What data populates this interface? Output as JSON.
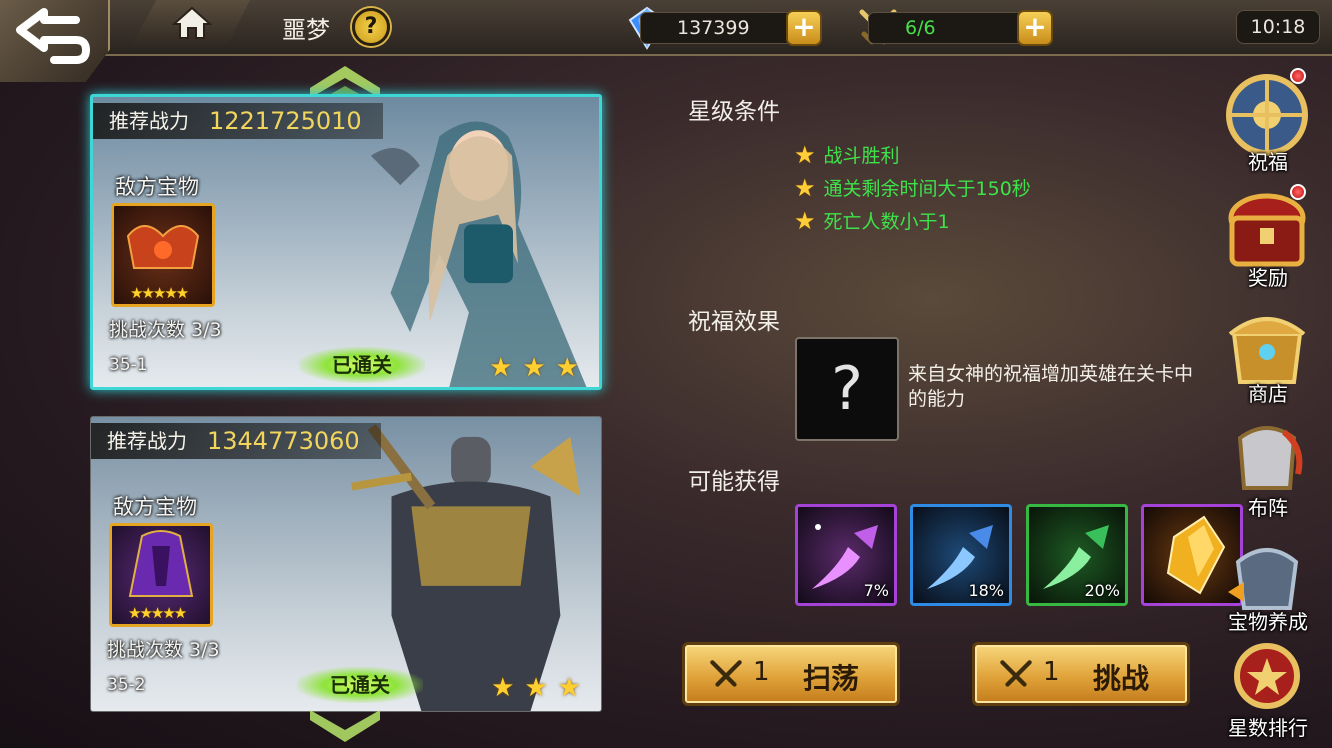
{
  "header": {
    "title": "噩梦",
    "gems": "137399",
    "stamina": "6/6",
    "time": "10:18",
    "plus_label": "+"
  },
  "stages": [
    {
      "power_label": "推荐战力",
      "power": "1221725010",
      "treasure_label": "敌方宝物",
      "treasure_stars": "★★★★★",
      "attempts": "挑战次数 3/3",
      "stage_id": "35-1",
      "status": "已通关",
      "stars": "★★★",
      "selected": true
    },
    {
      "power_label": "推荐战力",
      "power": "1344773060",
      "treasure_label": "敌方宝物",
      "treasure_stars": "★★★★★",
      "attempts": "挑战次数 3/3",
      "stage_id": "35-2",
      "status": "已通关",
      "stars": "★★★",
      "selected": false
    }
  ],
  "star_conditions": {
    "title": "星级条件",
    "items": [
      "战斗胜利",
      "通关剩余时间大于150秒",
      "死亡人数小于1"
    ]
  },
  "blessing": {
    "title": "祝福效果",
    "icon": "?",
    "description": "来自女神的祝福增加英雄在关卡中的能力"
  },
  "rewards": {
    "title": "可能获得",
    "items": [
      {
        "icon": "purple-dagger-icon",
        "pct": "7%",
        "color": "#a542d8"
      },
      {
        "icon": "blue-dagger-icon",
        "pct": "18%",
        "color": "#2f8ce6"
      },
      {
        "icon": "green-dagger-icon",
        "pct": "20%",
        "color": "#36b842"
      },
      {
        "icon": "gold-crystal-icon",
        "pct": "",
        "color": "#a542d8"
      }
    ]
  },
  "actions": {
    "sweep_cost": "1",
    "sweep_label": "扫荡",
    "challenge_cost": "1",
    "challenge_label": "挑战"
  },
  "side_menu": [
    {
      "label": "祝福",
      "icon": "blessing-compass-icon",
      "badge": true
    },
    {
      "label": "奖励",
      "icon": "reward-chest-icon",
      "badge": true
    },
    {
      "label": "商店",
      "icon": "shop-chest-icon",
      "badge": false
    },
    {
      "label": "布阵",
      "icon": "formation-helmet-icon",
      "badge": false
    },
    {
      "label": "宝物养成",
      "icon": "treasure-armor-icon",
      "badge": false
    },
    {
      "label": "星数排行",
      "icon": "star-ranking-icon",
      "badge": false
    }
  ]
}
